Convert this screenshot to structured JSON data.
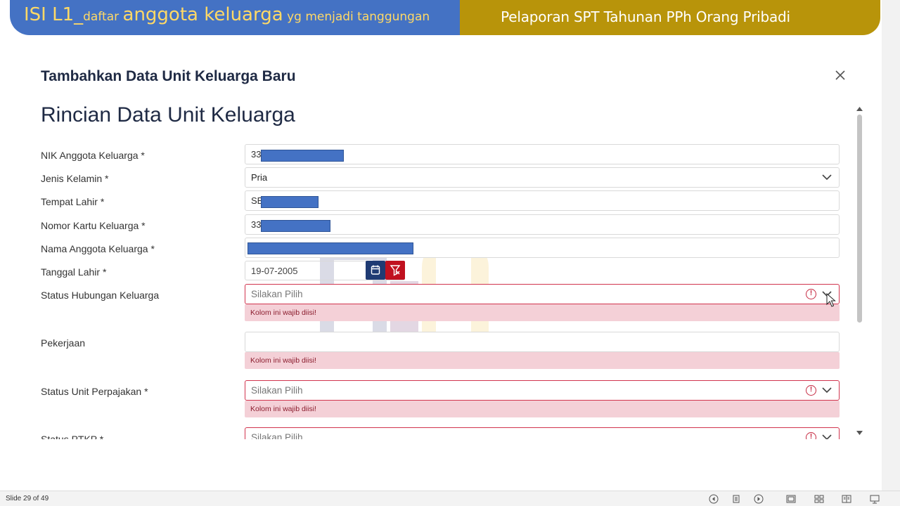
{
  "banner": {
    "left_part1": "ISI L1_",
    "left_part2": "daftar ",
    "left_part3": "anggota keluarga",
    "left_part4": " yg menjadi tanggungan",
    "right_title": "Pelaporan SPT Tahunan PPh Orang Pribadi"
  },
  "modal": {
    "title": "Tambahkan Data Unit Keluarga Baru",
    "section_title": "Rincian Data Unit Keluarga",
    "close_icon": "close-icon"
  },
  "form": {
    "nik": {
      "label": "NIK Anggota Keluarga *",
      "value": "33"
    },
    "gender": {
      "label": "Jenis Kelamin *",
      "value": "Pria"
    },
    "birthplace": {
      "label": "Tempat Lahir *",
      "value": "SE"
    },
    "kk": {
      "label": "Nomor Kartu Keluarga *",
      "value": "33"
    },
    "name": {
      "label": "Nama Anggota Keluarga *",
      "value": ""
    },
    "birthdate": {
      "label": "Tanggal Lahir *",
      "value": "19-07-2005"
    },
    "relation": {
      "label": "Status Hubungan Keluarga",
      "placeholder": "Silakan Pilih",
      "error": "Kolom ini wajib diisi!"
    },
    "job": {
      "label": "Pekerjaan",
      "value": "",
      "error": "Kolom ini wajib diisi!"
    },
    "tax_status": {
      "label": "Status Unit Perpajakan *",
      "placeholder": "Silakan Pilih",
      "error": "Kolom ini wajib diisi!"
    },
    "ptkp": {
      "label": "Status PTKP *",
      "placeholder": "Silakan Pilih"
    }
  },
  "statusbar": {
    "slide": "Slide 29 of 49"
  },
  "colors": {
    "banner_blue": "#4472c4",
    "banner_gold": "#b8940a",
    "error_red": "#c62b43",
    "calendar_btn": "#1f3b73",
    "clear_btn": "#c0111f"
  }
}
